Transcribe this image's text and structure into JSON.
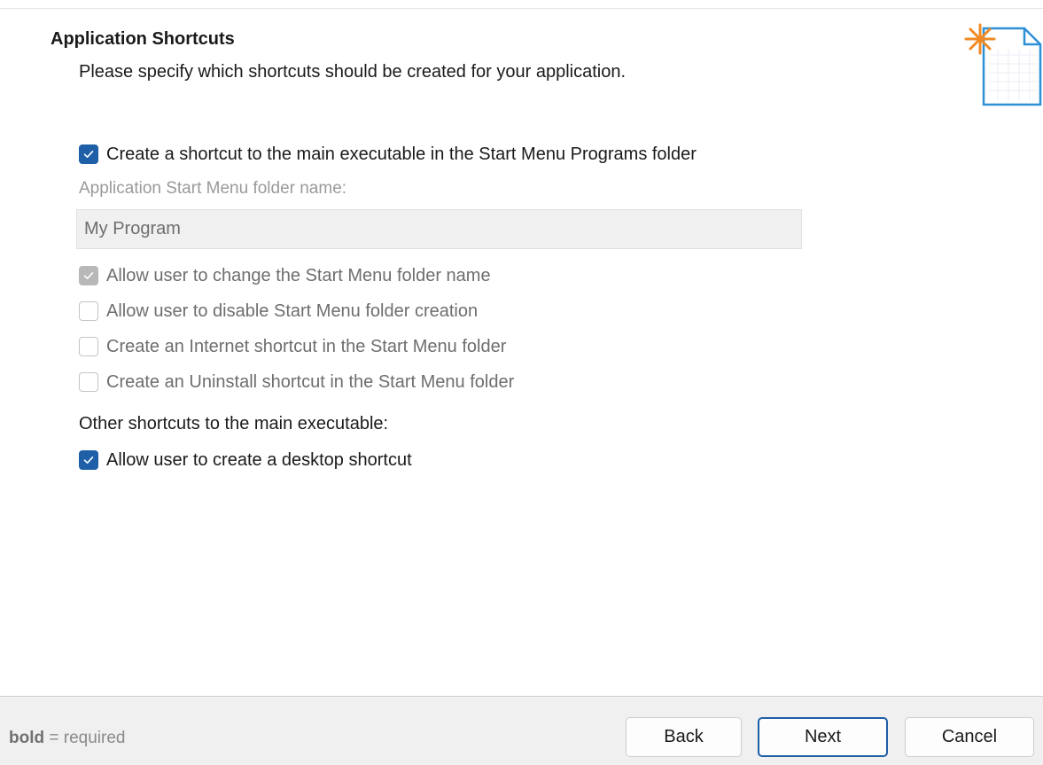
{
  "header": {
    "title": "Application Shortcuts",
    "subtitle": "Please specify which shortcuts should be created for your application.",
    "icon": "new-document-icon",
    "icon_accent_color": "#f08a24"
  },
  "options": {
    "start_menu_shortcut": {
      "label": "Create a shortcut to the main executable in the Start Menu Programs folder",
      "checked": true,
      "enabled": true
    },
    "folder_name_label": "Application Start Menu folder name:",
    "folder_name_value": "My Program",
    "allow_change_folder": {
      "label": "Allow user to change the Start Menu folder name",
      "checked": true,
      "enabled": false
    },
    "allow_disable_folder": {
      "label": "Allow user to disable Start Menu folder creation",
      "checked": false,
      "enabled": false
    },
    "internet_shortcut": {
      "label": "Create an Internet shortcut in the Start Menu folder",
      "checked": false,
      "enabled": false
    },
    "uninstall_shortcut": {
      "label": "Create an Uninstall shortcut in the Start Menu folder",
      "checked": false,
      "enabled": false
    },
    "other_shortcuts_label": "Other shortcuts to the main executable:",
    "desktop_shortcut": {
      "label": "Allow user to create a desktop shortcut",
      "checked": true,
      "enabled": true
    }
  },
  "footer": {
    "legend_bold": "bold",
    "legend_rest": " = required",
    "back_label": "Back",
    "next_label": "Next",
    "cancel_label": "Cancel"
  },
  "colors": {
    "accent": "#1e5fa8",
    "footer_bg": "#f0f0f0",
    "disabled_text": "#6e6e6e"
  }
}
